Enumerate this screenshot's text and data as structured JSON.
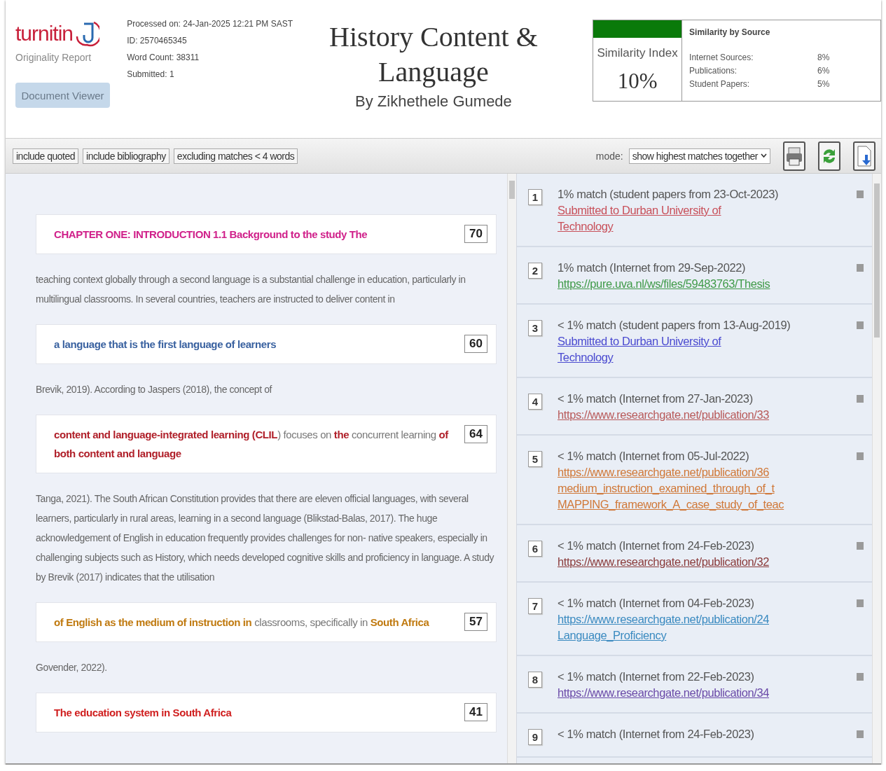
{
  "header": {
    "logo_text": "turnitin",
    "report_label": "Originality Report",
    "viewer_button": "Document Viewer",
    "meta": [
      "Processed on: 24-Jan-2025 12:21 PM SAST",
      "ID: 2570465345",
      "Word Count: 38311",
      "Submitted: 1"
    ],
    "title": "History Content & Language",
    "author": "By Zikhethele Gumede",
    "similarity": {
      "label": "Similarity Index",
      "value": "10%",
      "by_source_title": "Similarity by Source",
      "sources": [
        {
          "label": "Internet Sources:",
          "value": "8%"
        },
        {
          "label": "Publications:",
          "value": "6%"
        },
        {
          "label": "Student Papers:",
          "value": "5%"
        }
      ]
    }
  },
  "toolbar": {
    "filters": [
      "include quoted",
      "include bibliography",
      "excluding matches < 4 words"
    ],
    "mode_label": "mode:",
    "mode_value": "show highest matches together"
  },
  "document": [
    {
      "kind": "match",
      "number": "70",
      "color": "#d0208a",
      "segments": [
        {
          "text": "CHAPTER ONE: INTRODUCTION 1.1 Background to the study The",
          "matched": true
        }
      ]
    },
    {
      "kind": "text",
      "text": "teaching context globally through a second language is a substantial challenge in education, particularly in multilingual classrooms. In several countries, teachers are instructed to deliver content in"
    },
    {
      "kind": "match",
      "number": "60",
      "color": "#3a62a0",
      "segments": [
        {
          "text": "a language that is the first language of learners",
          "matched": true
        }
      ]
    },
    {
      "kind": "text",
      "text": "Brevik, 2019). According to Jaspers (2018), the concept of"
    },
    {
      "kind": "match",
      "number": "64",
      "color": "#b0202a",
      "segments": [
        {
          "text": "content and language-integrated learning (CLIL",
          "matched": true
        },
        {
          "text": ") focuses on ",
          "matched": false
        },
        {
          "text": "the",
          "matched": true
        },
        {
          "text": " concurrent learning ",
          "matched": false
        },
        {
          "text": "of both content and language",
          "matched": true
        }
      ]
    },
    {
      "kind": "text",
      "text": "Tanga, 2021). The South African Constitution provides that there are eleven official languages, with several learners, particularly in rural areas, learning in a second language (Blikstad-Balas, 2017). The huge acknowledgement of English in education frequently provides challenges for non- native speakers, especially in challenging subjects such as History, which needs developed cognitive skills and proficiency in language. A study by Brevik (2017) indicates that the utilisation"
    },
    {
      "kind": "match",
      "number": "57",
      "color": "#c07a10",
      "segments": [
        {
          "text": "of English as the medium of instruction in",
          "matched": true
        },
        {
          "text": " classrooms, specifically in ",
          "matched": false
        },
        {
          "text": "South Africa",
          "matched": true
        }
      ]
    },
    {
      "kind": "text",
      "text": "Govender, 2022)."
    },
    {
      "kind": "match",
      "number": "41",
      "color": "#d02020",
      "segments": [
        {
          "text": "The education system in South Africa",
          "matched": true
        }
      ]
    }
  ],
  "sources": [
    {
      "number": "1",
      "match": "1% match (student papers from 23-Oct-2023)",
      "color": "#c8505a",
      "link": [
        "Submitted to Durban University of",
        "Technology"
      ]
    },
    {
      "number": "2",
      "match": "1% match (Internet from 29-Sep-2022)",
      "color": "#3f9a48",
      "link": [
        "https://pure.uva.nl/ws/files/59483763/Thesis"
      ]
    },
    {
      "number": "3",
      "match": "< 1% match (student papers from 13-Aug-2019)",
      "color": "#4a4ad0",
      "link": [
        "Submitted to Durban University of",
        "Technology"
      ]
    },
    {
      "number": "4",
      "match": "< 1% match (Internet from 27-Jan-2023)",
      "color": "#b85a5a",
      "link": [
        "https://www.researchgate.net/publication/33"
      ]
    },
    {
      "number": "5",
      "match": "< 1% match (Internet from 05-Jul-2022)",
      "color": "#d07838",
      "link": [
        "https://www.researchgate.net/publication/36",
        "medium_instruction_examined_through_of_t",
        "MAPPING_framework_A_case_study_of_teac"
      ]
    },
    {
      "number": "6",
      "match": "< 1% match (Internet from 24-Feb-2023)",
      "color": "#8a3a3a",
      "link": [
        "https://www.researchgate.net/publication/32"
      ]
    },
    {
      "number": "7",
      "match": "< 1% match (Internet from 04-Feb-2023)",
      "color": "#3a8ac0",
      "link": [
        "https://www.researchgate.net/publication/24",
        "Language_Proficiency"
      ]
    },
    {
      "number": "8",
      "match": "< 1% match (Internet from 22-Feb-2023)",
      "color": "#6a4aa8",
      "link": [
        "https://www.researchgate.net/publication/34"
      ]
    },
    {
      "number": "9",
      "match": "< 1% match (Internet from 24-Feb-2023)"
    }
  ]
}
